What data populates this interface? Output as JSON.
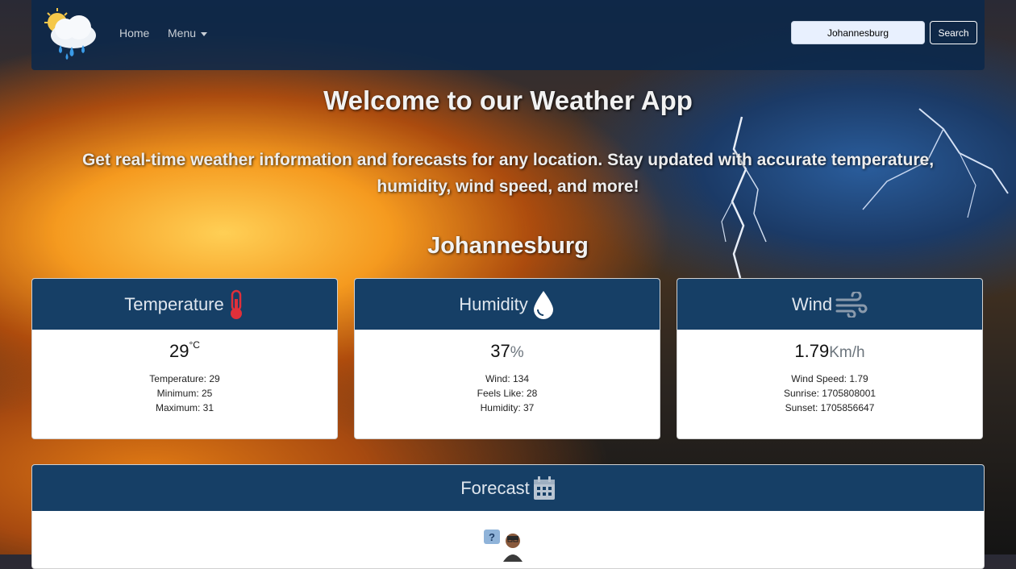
{
  "nav": {
    "home": "Home",
    "menu": "Menu",
    "search_value": "Johannesburg",
    "search_button": "Search"
  },
  "hero": {
    "title": "Welcome to our Weather App",
    "subtitle": "Get real-time weather information and forecasts for any location. Stay updated with accurate temperature, humidity, wind speed, and more!"
  },
  "location": "Johannesburg",
  "cards": {
    "temperature": {
      "title": "Temperature",
      "value": "29",
      "unit": "°C",
      "details": [
        "Temperature: 29",
        "Minimum: 25",
        "Maximum: 31"
      ]
    },
    "humidity": {
      "title": "Humidity",
      "value": "37",
      "unit": "%",
      "details": [
        "Wind: 134",
        "Feels Like: 28",
        "Humidity: 37"
      ]
    },
    "wind": {
      "title": "Wind",
      "value": "1.79",
      "unit": "Km/h",
      "details": [
        "Wind Speed: 1.79",
        "Sunrise: 1705808001",
        "Sunset: 1705856647"
      ]
    }
  },
  "forecast": {
    "title": "Forecast"
  },
  "icons": {
    "logo": "weather-cloud-rain-sun-icon",
    "temperature": "thermometer-icon",
    "humidity": "droplet-icon",
    "wind": "wind-icon",
    "forecast": "calendar-icon",
    "forecast_illustration": "person-question-icon"
  },
  "colors": {
    "nav_bg": "#0a284b",
    "card_header": "#163f66",
    "thermometer": "#e0303a"
  }
}
